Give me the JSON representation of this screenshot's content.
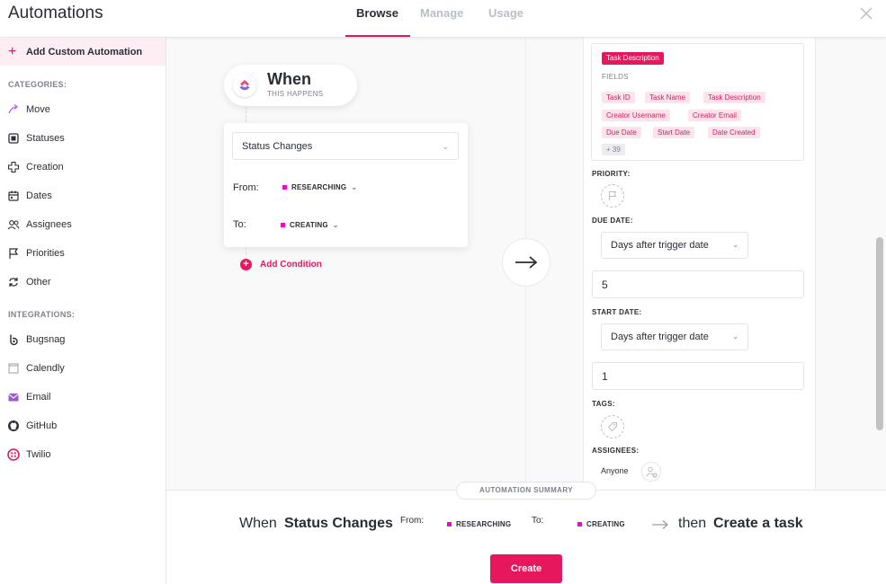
{
  "header": {
    "title": "Automations",
    "tabs": [
      {
        "label": "Browse",
        "active": true
      },
      {
        "label": "Manage",
        "active": false
      },
      {
        "label": "Usage",
        "active": false
      }
    ],
    "close_icon": "close-icon"
  },
  "sidebar": {
    "add_custom": "Add Custom Automation",
    "categories_title": "CATEGORIES:",
    "categories": [
      {
        "label": "Move",
        "icon": "move-icon"
      },
      {
        "label": "Statuses",
        "icon": "status-icon"
      },
      {
        "label": "Creation",
        "icon": "creation-icon"
      },
      {
        "label": "Dates",
        "icon": "calendar-icon"
      },
      {
        "label": "Assignees",
        "icon": "assignees-icon"
      },
      {
        "label": "Priorities",
        "icon": "flag-icon"
      },
      {
        "label": "Other",
        "icon": "other-icon"
      }
    ],
    "integrations_title": "INTEGRATIONS:",
    "integrations": [
      {
        "label": "Bugsnag",
        "icon": "bugsnag-icon"
      },
      {
        "label": "Calendly",
        "icon": "calendly-icon"
      },
      {
        "label": "Email",
        "icon": "email-icon"
      },
      {
        "label": "GitHub",
        "icon": "github-icon"
      },
      {
        "label": "Twilio",
        "icon": "twilio-icon"
      }
    ]
  },
  "trigger": {
    "title": "When",
    "subtitle": "THIS HAPPENS",
    "select_value": "Status Changes",
    "from_label": "From:",
    "from_status": "RESEARCHING",
    "to_label": "To:",
    "to_status": "CREATING",
    "add_condition": "Add Condition"
  },
  "action": {
    "variable_head": "Task Description",
    "fields_label": "FIELDS",
    "fields": [
      "Task ID",
      "Task Name",
      "Task Description",
      "Creator Username",
      "Creator Email",
      "Due Date",
      "Start Date",
      "Date Created"
    ],
    "more": "+ 39",
    "priority_label": "PRIORITY:",
    "due_date_label": "DUE DATE:",
    "due_date_mode": "Days after trigger date",
    "due_date_value": "5",
    "start_date_label": "START DATE:",
    "start_date_mode": "Days after trigger date",
    "start_date_value": "1",
    "tags_label": "TAGS:",
    "assignees_label": "ASSIGNEES:",
    "assignees_value": "Anyone"
  },
  "summary": {
    "pill": "AUTOMATION SUMMARY",
    "when": "When",
    "trigger": "Status Changes",
    "from_label": "From:",
    "from_status": "RESEARCHING",
    "to_label": "To:",
    "to_status": "CREATING",
    "then": "then",
    "action": "Create a task",
    "create_button": "Create"
  },
  "colors": {
    "accent": "#e6175c",
    "status": "#e50ec5"
  }
}
